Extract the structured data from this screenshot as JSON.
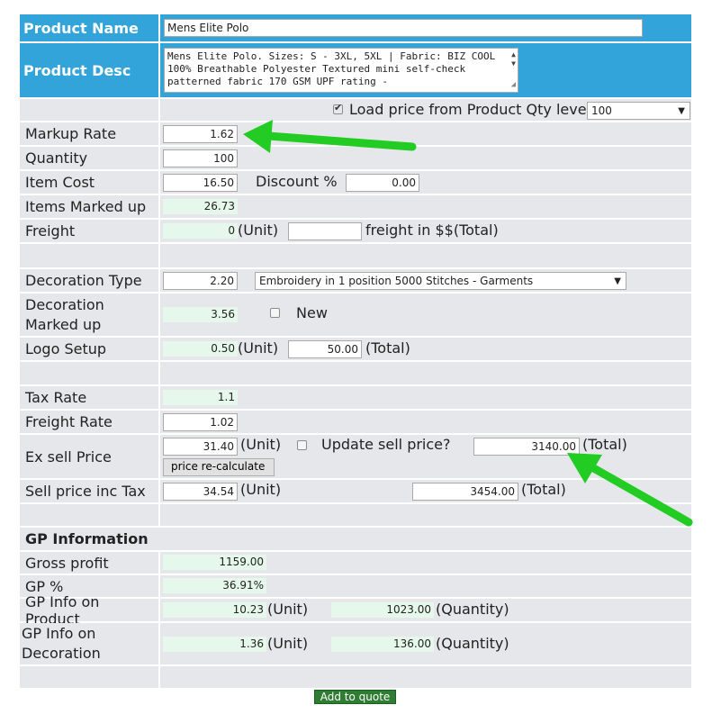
{
  "product": {
    "name_label": "Product Name",
    "name_value": "Mens Elite Polo",
    "desc_label": "Product Desc",
    "desc_value": "Mens Elite Polo. Sizes: S - 3XL, 5XL | Fabric: BIZ COOL 100% Breathable Polyester Textured mini self-check patterned fabric 170 GSM UPF rating -"
  },
  "qty_price": {
    "checkbox_label": "Load price from Product Qty level",
    "select_value": "100"
  },
  "pricing": {
    "markup_label": "Markup Rate",
    "markup_value": "1.62",
    "quantity_label": "Quantity",
    "quantity_value": "100",
    "item_cost_label": "Item Cost",
    "item_cost_value": "16.50",
    "discount_label": "Discount %",
    "discount_value": "0.00",
    "items_marked_label": "Items Marked up",
    "items_marked_value": "26.73",
    "freight_label": "Freight",
    "freight_unit_value": "0",
    "freight_unit_suffix": "(Unit)",
    "freight_total_value": "",
    "freight_total_suffix": "freight in $$(Total)"
  },
  "decoration": {
    "type_label": "Decoration Type",
    "type_value": "2.20",
    "type_select": "Embroidery in 1 position 5000 Stitches - Garments",
    "marked_label": "Decoration Marked up",
    "marked_value": "3.56",
    "new_label": "New",
    "logo_label": "Logo Setup",
    "logo_unit_value": "0.50",
    "logo_unit_suffix": "(Unit)",
    "logo_total_value": "50.00",
    "logo_total_suffix": "(Total)"
  },
  "tax": {
    "tax_rate_label": "Tax Rate",
    "tax_rate_value": "1.1",
    "freight_rate_label": "Freight Rate",
    "freight_rate_value": "1.02",
    "ex_sell_label": "Ex sell Price",
    "ex_sell_value": "31.40",
    "ex_sell_suffix": "(Unit)",
    "update_label": "Update sell price?",
    "ex_sell_total": "3140.00",
    "ex_sell_total_suffix": "(Total)",
    "recalc_button": "price re-calculate",
    "inc_tax_label": "Sell price inc Tax",
    "inc_tax_value": "34.54",
    "inc_tax_suffix": "(Unit)",
    "inc_tax_total": "3454.00",
    "inc_tax_total_suffix": "(Total)"
  },
  "gp": {
    "section_label": "GP Information",
    "gross_label": "Gross profit",
    "gross_value": "1159.00",
    "pct_label": "GP %",
    "pct_value": "36.91%",
    "product_label": "GP Info on Product",
    "product_unit": "10.23",
    "product_unit_suffix": "(Unit)",
    "product_qty": "1023.00",
    "product_qty_suffix": "(Quantity)",
    "deco_label": "GP Info on Decoration",
    "deco_unit": "1.36",
    "deco_unit_suffix": "(Unit)",
    "deco_qty": "136.00",
    "deco_qty_suffix": "(Quantity)"
  },
  "actions": {
    "add_quote": "Add to quote"
  },
  "colors": {
    "header_blue": "#33a4d9",
    "row_gray": "#e5e7ea",
    "readonly_green": "#e6f8ec",
    "arrow_green": "#22cc22"
  }
}
